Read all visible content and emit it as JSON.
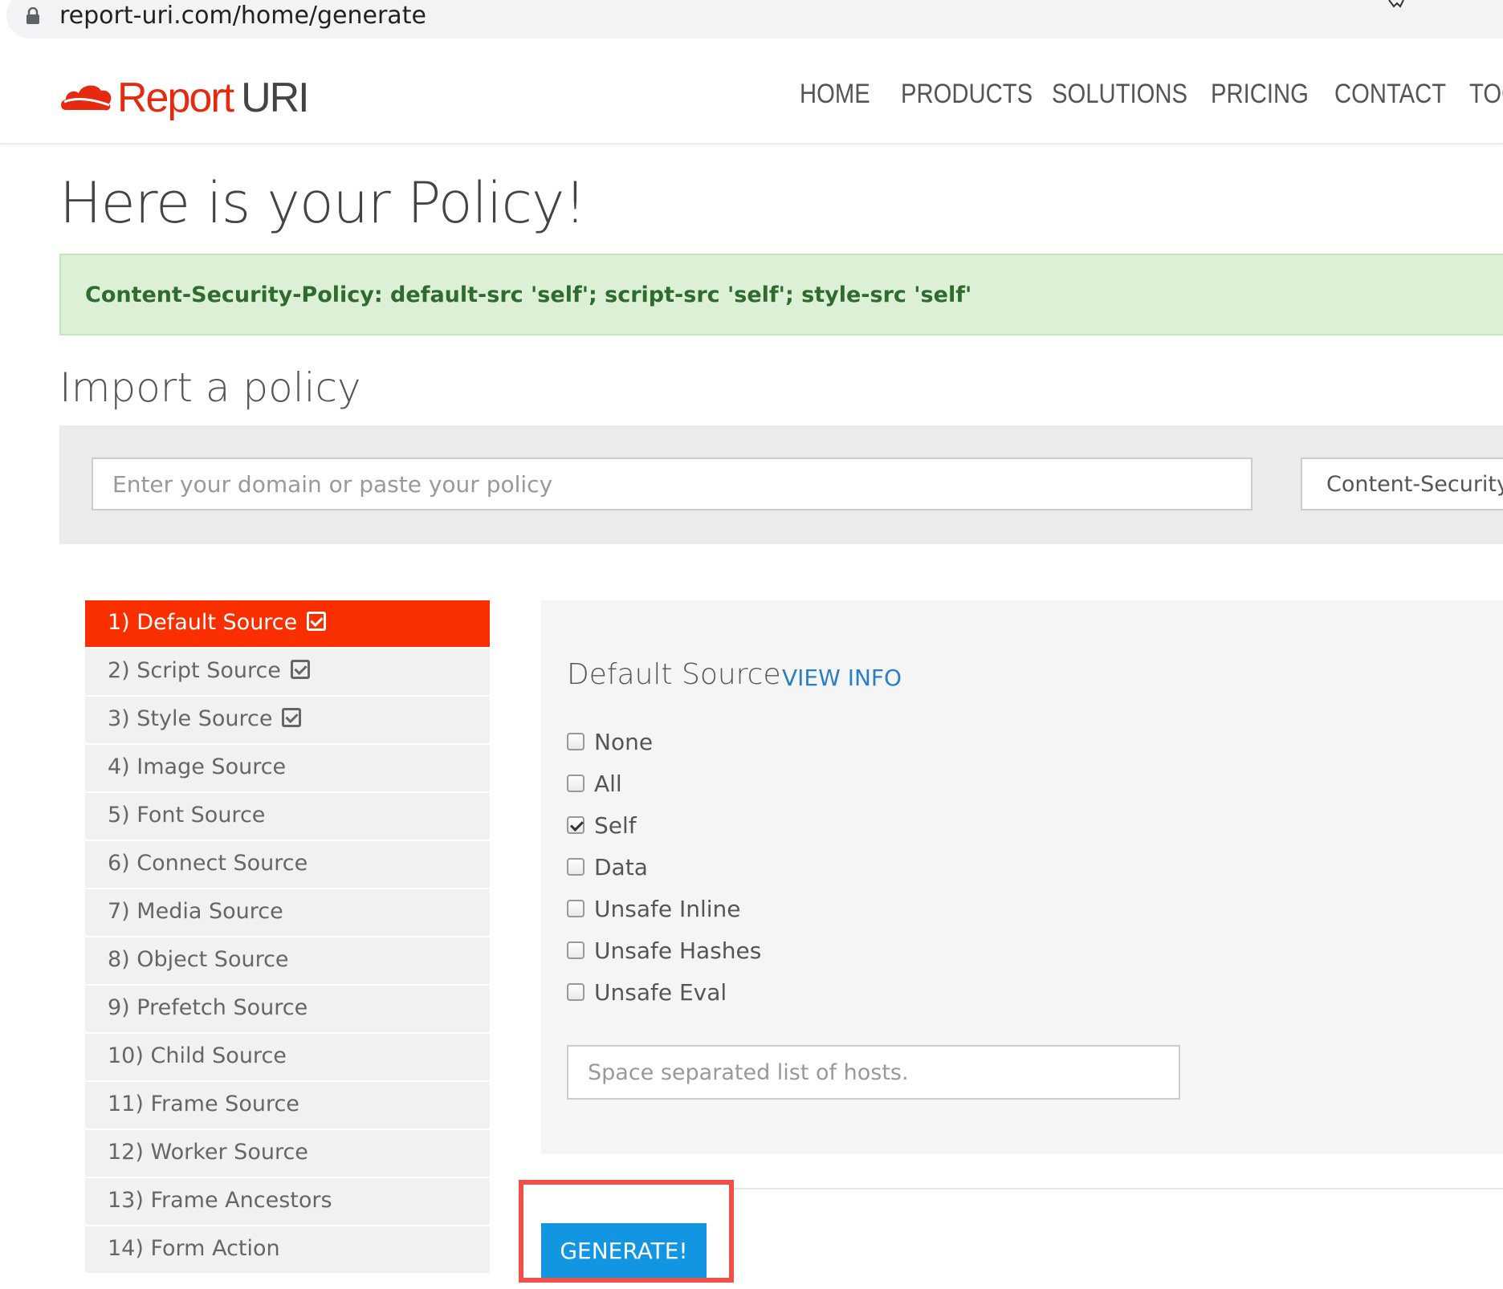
{
  "browser": {
    "url": "report-uri.com/home/generate"
  },
  "brand": {
    "name_part1": "Report",
    "name_part2": "URI",
    "accent": "#e62a10"
  },
  "nav": {
    "items": [
      "HOME",
      "PRODUCTS",
      "SOLUTIONS",
      "PRICING",
      "CONTACT",
      "TOO"
    ]
  },
  "page": {
    "title": "Here is your Policy!",
    "policy_output": "Content-Security-Policy: default-src 'self'; script-src 'self'; style-src 'self'",
    "import_heading": "Import a policy",
    "import_placeholder": "Enter your domain or paste your policy",
    "import_select_value": "Content-Security-"
  },
  "sidebar": {
    "items": [
      {
        "label": "1) Default Source",
        "checked": true,
        "active": true
      },
      {
        "label": "2) Script Source",
        "checked": true
      },
      {
        "label": "3) Style Source",
        "checked": true
      },
      {
        "label": "4) Image Source"
      },
      {
        "label": "5) Font Source"
      },
      {
        "label": "6) Connect Source"
      },
      {
        "label": "7) Media Source"
      },
      {
        "label": "8) Object Source"
      },
      {
        "label": "9) Prefetch Source"
      },
      {
        "label": "10) Child Source"
      },
      {
        "label": "11) Frame Source"
      },
      {
        "label": "12) Worker Source"
      },
      {
        "label": "13) Frame Ancestors"
      },
      {
        "label": "14) Form Action"
      }
    ]
  },
  "panel": {
    "title": "Default Source",
    "view_info": "VIEW INFO",
    "options": [
      {
        "label": "None",
        "checked": false
      },
      {
        "label": "All",
        "checked": false
      },
      {
        "label": "Self",
        "checked": true
      },
      {
        "label": "Data",
        "checked": false
      },
      {
        "label": "Unsafe Inline",
        "checked": false
      },
      {
        "label": "Unsafe Hashes",
        "checked": false
      },
      {
        "label": "Unsafe Eval",
        "checked": false
      }
    ],
    "hosts_placeholder": "Space separated list of hosts."
  },
  "actions": {
    "generate_label": "GENERATE!",
    "button_color": "#1396e2",
    "highlight_color": "#f0504a"
  }
}
